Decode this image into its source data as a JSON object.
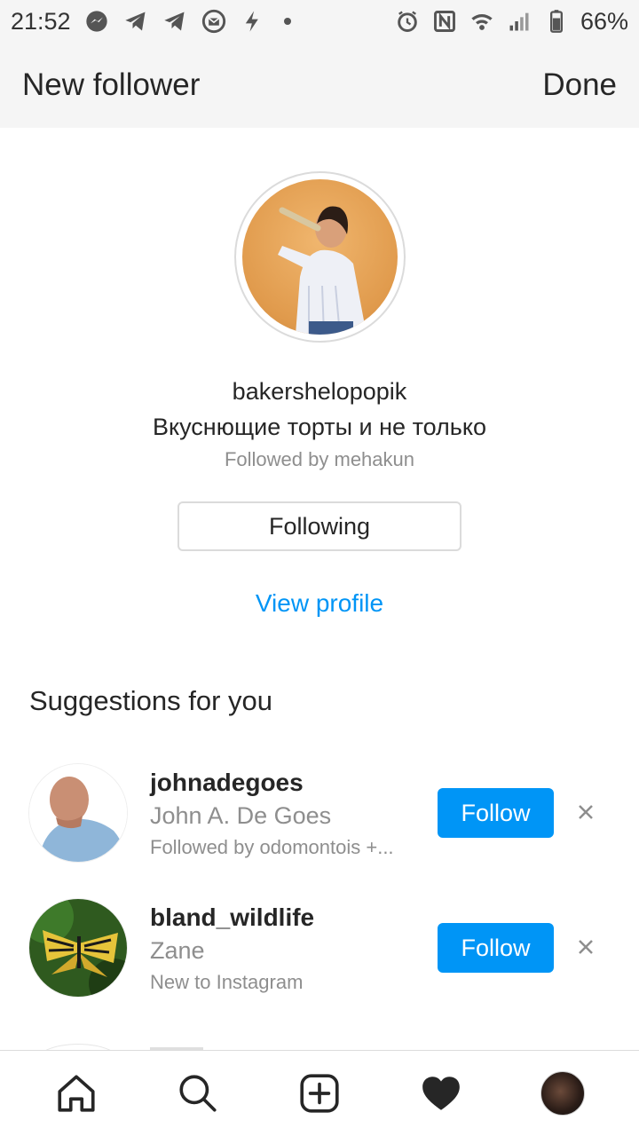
{
  "status_bar": {
    "time": "21:52",
    "battery": "66%",
    "left_icons": [
      "messenger-icon",
      "telegram-icon",
      "telegram-icon",
      "mail-icon",
      "flash-icon",
      "dot-icon"
    ],
    "right_icons": [
      "alarm-icon",
      "nfc-icon",
      "wifi-icon",
      "signal-icon",
      "battery-icon"
    ]
  },
  "top_bar": {
    "title": "New follower",
    "done_label": "Done"
  },
  "profile": {
    "username": "bakershelopopik",
    "bio": "Вкуснющие торты и не только",
    "followed_by": "Followed by mehakun",
    "following_label": "Following",
    "view_profile_label": "View profile"
  },
  "suggestions": {
    "title": "Suggestions for you",
    "items": [
      {
        "username": "johnadegoes",
        "name": "John A. De Goes",
        "subtitle": "Followed by odomontois +...",
        "follow_label": "Follow"
      },
      {
        "username": "bland_wildlife",
        "name": "Zane",
        "subtitle": "New to Instagram",
        "follow_label": "Follow"
      }
    ]
  },
  "bottom_nav": {
    "items": [
      "home-icon",
      "search-icon",
      "add-post-icon",
      "heart-icon",
      "profile-avatar"
    ]
  },
  "colors": {
    "accent": "#0095f6",
    "secondary_text": "#8e8e8e",
    "primary_text": "#262626",
    "bar_bg": "#f5f5f5"
  }
}
